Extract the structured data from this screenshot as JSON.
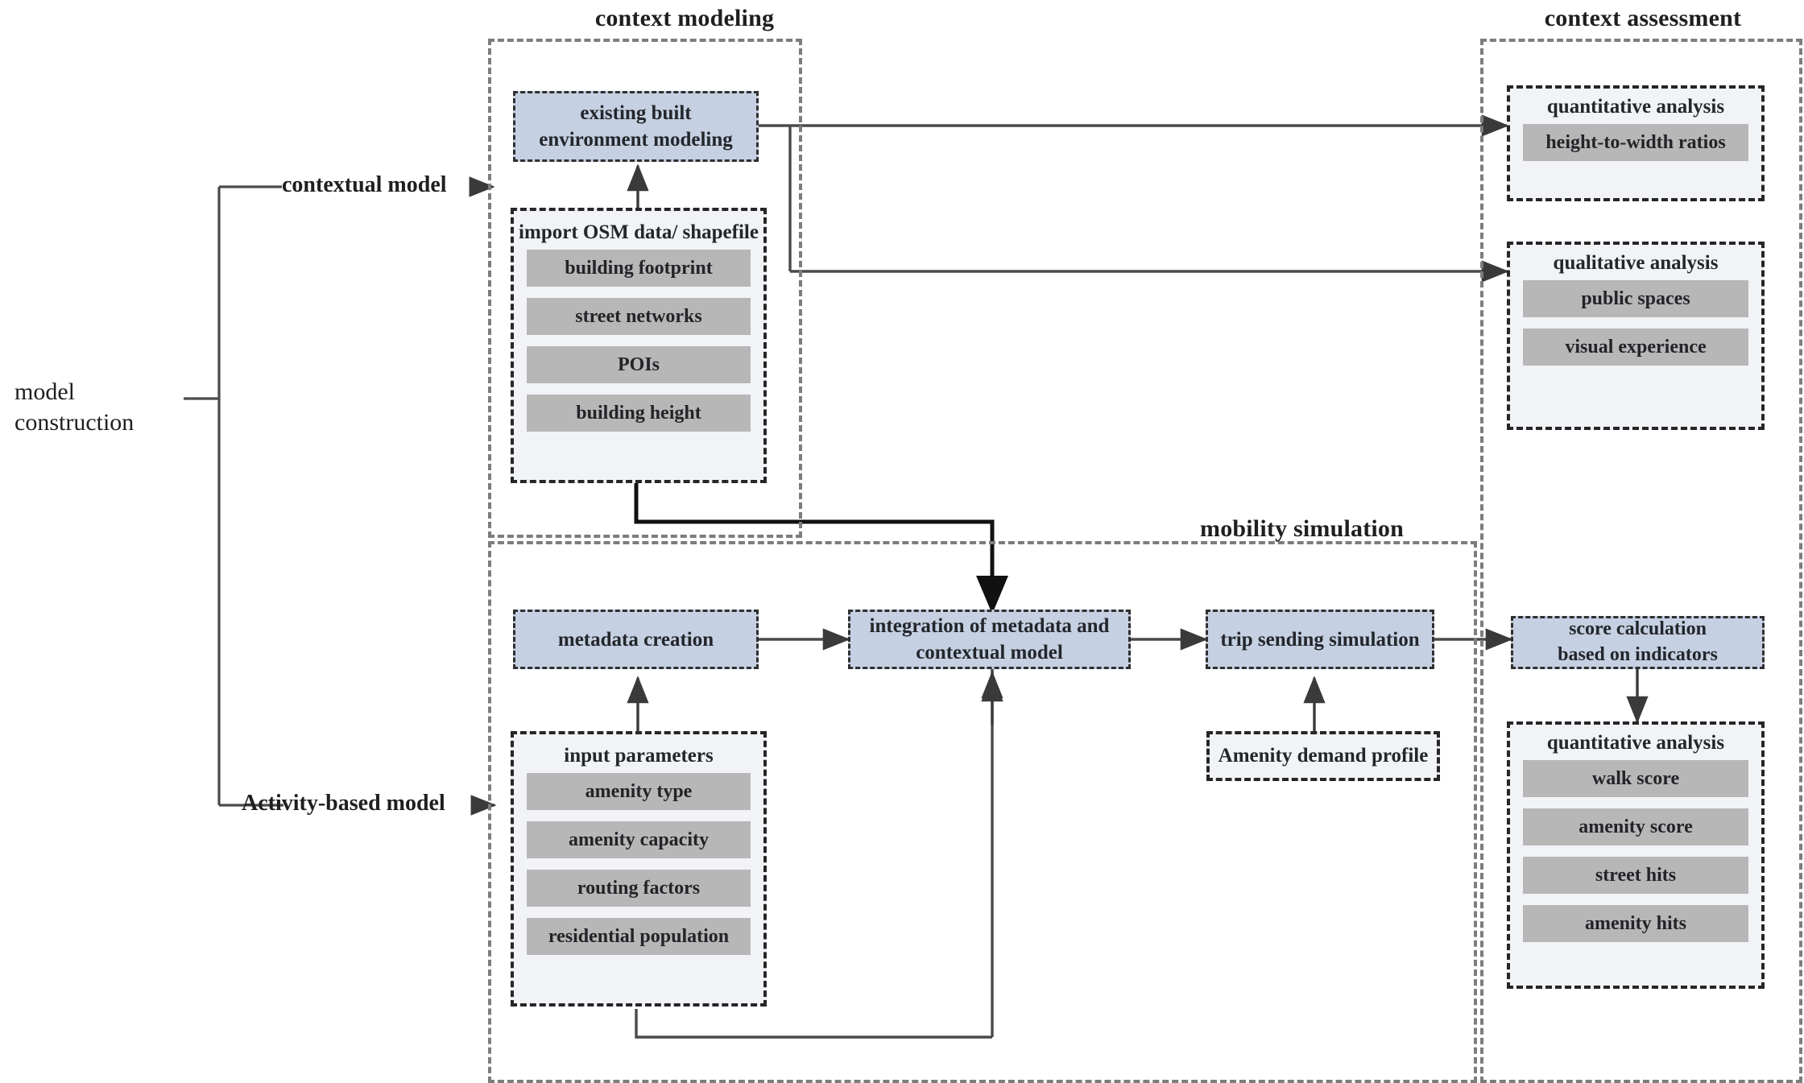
{
  "diagram": {
    "root_label_line1": "model",
    "root_label_line2": "construction",
    "branches": [
      {
        "label": "contextual model"
      },
      {
        "label": "Activity-based model"
      }
    ],
    "groups": [
      {
        "id": "context-modeling",
        "title": "context modeling"
      },
      {
        "id": "context-assessment",
        "title": "context assessment"
      },
      {
        "id": "mobility-simulation",
        "title": "mobility simulation"
      }
    ],
    "nodes": {
      "existing_built_environment": {
        "line1": "existing built",
        "line2": "environment modeling"
      },
      "metadata_creation": {
        "line1": "metadata creation"
      },
      "integration": {
        "line1": "integration of metadata and",
        "line2": "contextual model"
      },
      "trip_sending": {
        "line1": "trip sending simulation"
      },
      "score_calculation": {
        "line1": "score calculation",
        "line2": "based on indicators"
      }
    },
    "panels": {
      "osm_import": {
        "title": "import OSM data/ shapefile",
        "items": [
          "building footprint",
          "street networks",
          "POIs",
          "building height"
        ]
      },
      "input_parameters": {
        "title": "input parameters",
        "items": [
          "amenity type",
          "amenity capacity",
          "routing factors",
          "residential population"
        ]
      },
      "quantitative_context": {
        "title": "quantitative analysis",
        "items": [
          "height-to-width ratios"
        ]
      },
      "qualitative_context": {
        "title": "qualitative analysis",
        "items": [
          "public spaces",
          "visual experience"
        ]
      },
      "quantitative_mobility": {
        "title": "quantitative analysis",
        "items": [
          "walk score",
          "amenity score",
          "street hits",
          "amenity hits"
        ]
      },
      "amenity_demand": {
        "title": "Amenity demand profile"
      }
    },
    "colors": {
      "node_fill": "#c5d0e2",
      "panel_fill": "#f1f3f7",
      "item_fill": "#b7b7b7",
      "group_border": "#7d7d7d",
      "node_border": "#2f2f2f",
      "connector": "#4a4a4a",
      "text": "#23262b",
      "background": "#ffffff"
    }
  }
}
